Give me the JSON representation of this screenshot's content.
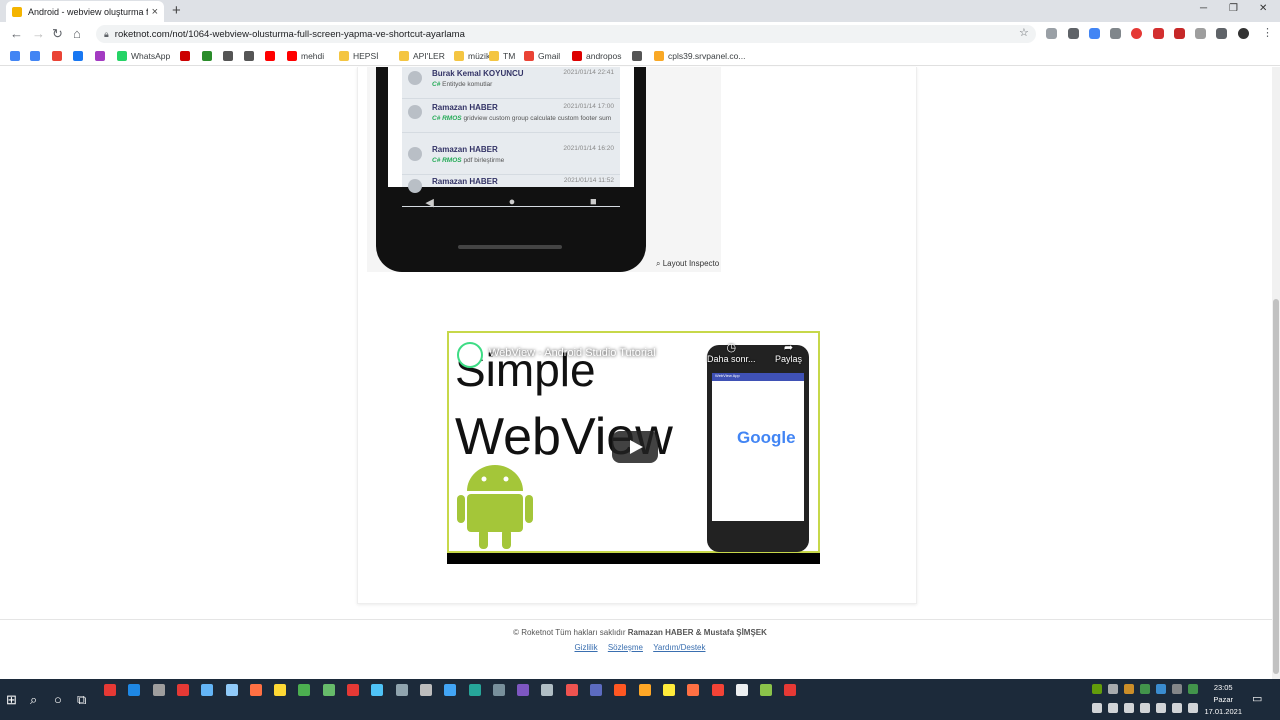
{
  "browser": {
    "tab_title": "Android - webview oluşturma full",
    "tab_close": "×",
    "new_tab": "+",
    "url": "roketnot.com/not/1064-webview-olusturma-full-screen-yapma-ve-shortcut-ayarlama",
    "window_min": "─",
    "window_restore": "❐",
    "window_close": "✕"
  },
  "bookmarks": [
    {
      "label": "",
      "color": "#4285f4"
    },
    {
      "label": "",
      "color": "#4285f4"
    },
    {
      "label": "",
      "color": "#ea4335"
    },
    {
      "label": "",
      "color": "#1877f2"
    },
    {
      "label": "",
      "color": "#a33bc2"
    },
    {
      "label": "WhatsApp",
      "color": "#25d366"
    },
    {
      "label": "",
      "color": "#c00"
    },
    {
      "label": "",
      "color": "#2a8c2a"
    },
    {
      "label": "",
      "color": "#555"
    },
    {
      "label": "",
      "color": "#555"
    },
    {
      "label": "",
      "color": "#f00"
    },
    {
      "label": "mehdi",
      "color": "#f00"
    },
    {
      "label": "HEPSİ",
      "color": "#f4c542"
    },
    {
      "label": "API'LER",
      "color": "#f4c542"
    },
    {
      "label": "müzik",
      "color": "#f4c542"
    },
    {
      "label": "TM",
      "color": "#f4c542"
    },
    {
      "label": "Gmail",
      "color": "#ea4335"
    },
    {
      "label": "andropos",
      "color": "#d00"
    },
    {
      "label": "",
      "color": "#555"
    },
    {
      "label": "cpls39.srvpanel.co...",
      "color": "#f9a825"
    }
  ],
  "phone_list": [
    {
      "name": "Burak Kemal KOYUNCU",
      "date": "2021/01/14 22:41",
      "tag": "C#",
      "desc": "Entityde komutlar"
    },
    {
      "name": "Ramazan HABER",
      "date": "2021/01/14 17:00",
      "tag": "C# RMOS",
      "desc": "gridview custom group calculate custom footer sum"
    },
    {
      "name": "Ramazan HABER",
      "date": "2021/01/14 16:20",
      "tag": "C# RMOS",
      "desc": "pdf birleştirme"
    },
    {
      "name": "Ramazan HABER",
      "date": "2021/01/14 11:52",
      "tag": "",
      "desc": ""
    }
  ],
  "phone_nav": {
    "back": "◀",
    "home": "●",
    "recents": "■"
  },
  "layout_inspector": "Layout Inspecto",
  "video": {
    "title": "WebView - Android Studio Tutorial",
    "big_text_1": "Simple",
    "big_text_2": "WebView",
    "watch_later": "Daha sonr...",
    "share": "Paylaş",
    "google_word": "Google",
    "mini_app_title": "WebView App"
  },
  "footer": {
    "copyright": "© Roketnot Tüm hakları saklıdır",
    "authors": "Ramazan HABER & Mustafa ŞİMŞEK",
    "links": [
      "Gizlilik",
      "Sözleşme",
      "Yardım/Destek"
    ]
  },
  "clock": {
    "time": "23:05",
    "day": "Pazar",
    "date": "17.01.2021"
  }
}
